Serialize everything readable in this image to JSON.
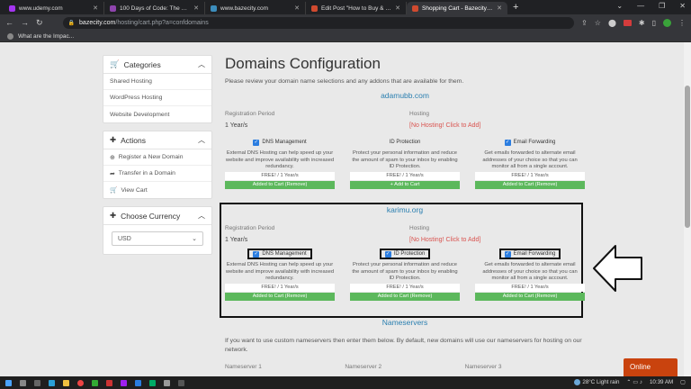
{
  "browser": {
    "tabs": [
      {
        "label": "www.udemy.com",
        "color": "#a435f0",
        "active": false
      },
      {
        "label": "100 Days of Code: The Complete",
        "color": "#8e44ad",
        "active": false
      },
      {
        "label": "www.bazecity.com",
        "color": "#3c8dbc",
        "active": false
      },
      {
        "label": "Edit Post \"How to Buy & Host a",
        "color": "#d04a2f",
        "active": false
      },
      {
        "label": "Shopping Cart - Bazecity Hosting",
        "color": "#d04a2f",
        "active": true
      }
    ],
    "new_tab": "+",
    "url_host": "bazecity.com",
    "url_path": "/hosting/cart.php?a=confdomains",
    "bookmark": "What are the Impac..."
  },
  "sidebar": {
    "categories": {
      "title": "Categories",
      "items": [
        "Shared Hosting",
        "WordPress Hosting",
        "Website Development"
      ]
    },
    "actions": {
      "title": "Actions",
      "items": [
        "Register a New Domain",
        "Transfer in a Domain",
        "View Cart"
      ]
    },
    "currency": {
      "title": "Choose Currency",
      "selected": "USD"
    }
  },
  "main": {
    "title": "Domains Configuration",
    "subtitle": "Please review your domain name selections and any addons that are available for them.",
    "domains": [
      {
        "name": "adamubb.com",
        "reg_label": "Registration Period",
        "reg_value": "1 Year/s",
        "hosting_label": "Hosting",
        "hosting_value": "[No Hosting! Click to Add]",
        "addons": [
          {
            "title": "DNS Management",
            "checked": true,
            "desc": "External DNS Hosting can help speed up your website and improve availability with increased redundancy.",
            "price": "FREE! / 1 Year/s",
            "button": "Added to Cart (Remove)"
          },
          {
            "title": "ID Protection",
            "checked": false,
            "desc": "Protect your personal information and reduce the amount of spam to your inbox by enabling ID Protection.",
            "price": "FREE! / 1 Year/s",
            "button": "+ Add to Cart"
          },
          {
            "title": "Email Forwarding",
            "checked": true,
            "desc": "Get emails forwarded to alternate email addresses of your choice so that you can monitor all from a single account.",
            "price": "FREE! / 1 Year/s",
            "button": "Added to Cart (Remove)"
          }
        ]
      },
      {
        "name": "karimu.org",
        "reg_label": "Registration Period",
        "reg_value": "1 Year/s",
        "hosting_label": "Hosting",
        "hosting_value": "[No Hosting! Click to Add]",
        "addons": [
          {
            "title": "DNS Management",
            "checked": true,
            "desc": "External DNS Hosting can help speed up your website and improve availability with increased redundancy.",
            "price": "FREE! / 1 Year/s",
            "button": "Added to Cart (Remove)"
          },
          {
            "title": "ID Protection",
            "checked": true,
            "desc": "Protect your personal information and reduce the amount of spam to your inbox by enabling ID Protection.",
            "price": "FREE! / 1 Year/s",
            "button": "Added to Cart (Remove)"
          },
          {
            "title": "Email Forwarding",
            "checked": true,
            "desc": "Get emails forwarded to alternate email addresses of your choice so that you can monitor all from a single account.",
            "price": "FREE! / 1 Year/s",
            "button": "Added to Cart (Remove)"
          }
        ]
      }
    ],
    "nameservers": {
      "title": "Nameservers",
      "desc": "If you want to use custom nameservers then enter them below. By default, new domains will use our nameservers for hosting on our network.",
      "labels": [
        "Nameserver 1",
        "Nameserver 2",
        "Nameserver 3"
      ]
    }
  },
  "chat": {
    "label": "Online"
  },
  "taskbar": {
    "weather": "28°C  Light rain",
    "time": "10:39 AM"
  },
  "colors": {
    "accent": "#2a7fb0",
    "success": "#5cb85c",
    "danger": "#d9534f",
    "chat": "#c9430e"
  }
}
